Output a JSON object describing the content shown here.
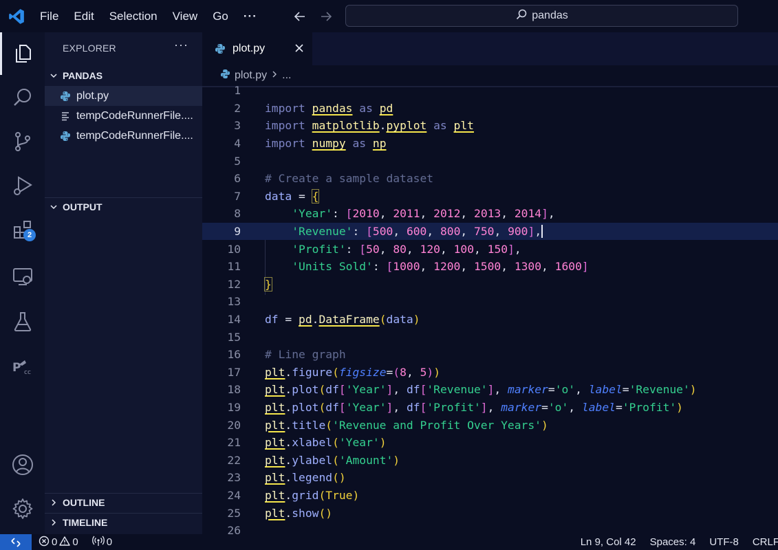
{
  "menu": {
    "items": [
      "File",
      "Edit",
      "Selection",
      "View",
      "Go"
    ],
    "overflow": "···"
  },
  "search": {
    "text": "pandas"
  },
  "activity": {
    "items": [
      "explorer-icon",
      "search-icon",
      "source-control-icon",
      "run-debug-icon",
      "extensions-icon",
      "remote-explorer-icon",
      "testing-icon",
      "pascal-cc-icon",
      "account-icon",
      "settings-gear-icon"
    ],
    "extensions_badge": "2"
  },
  "sidebar": {
    "title": "EXPLORER",
    "more": "···",
    "folder": "PANDAS",
    "files": [
      "plot.py",
      "tempCodeRunnerFile....",
      "tempCodeRunnerFile...."
    ],
    "output": "OUTPUT",
    "outline": "OUTLINE",
    "timeline": "TIMELINE"
  },
  "editor": {
    "tab_label": "plot.py",
    "breadcrumb_file": "plot.py",
    "breadcrumb_more": "...",
    "current_line": 9,
    "line_numbers": [
      "1",
      "2",
      "3",
      "4",
      "5",
      "6",
      "7",
      "8",
      "9",
      "10",
      "11",
      "12",
      "13",
      "14",
      "15",
      "16",
      "17",
      "18",
      "19",
      "20",
      "21",
      "22",
      "23",
      "24",
      "25",
      "26"
    ]
  },
  "statusbar": {
    "errors": "0",
    "warnings": "0",
    "ports": "0",
    "position": "Ln 9, Col 42",
    "spaces": "Spaces: 4",
    "encoding": "UTF-8",
    "eol": "CRLF"
  },
  "colors": {
    "accent": "#1f5fc4",
    "keyword": "#7d84c4",
    "string": "#34d08f",
    "number": "#ff82d4",
    "comment": "#636c93",
    "bracket": "#f1d13b"
  }
}
